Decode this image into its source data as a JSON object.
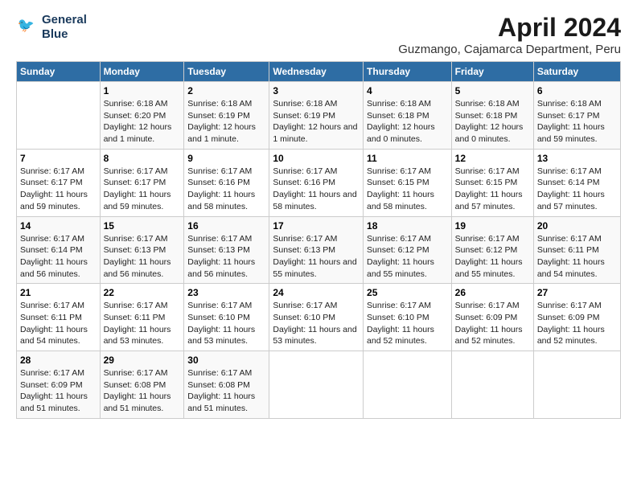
{
  "logo": {
    "line1": "General",
    "line2": "Blue"
  },
  "title": "April 2024",
  "subtitle": "Guzmango, Cajamarca Department, Peru",
  "weekdays": [
    "Sunday",
    "Monday",
    "Tuesday",
    "Wednesday",
    "Thursday",
    "Friday",
    "Saturday"
  ],
  "weeks": [
    [
      {
        "day": null
      },
      {
        "day": "1",
        "sunrise": "6:18 AM",
        "sunset": "6:20 PM",
        "daylight": "12 hours and 1 minute."
      },
      {
        "day": "2",
        "sunrise": "6:18 AM",
        "sunset": "6:19 PM",
        "daylight": "12 hours and 1 minute."
      },
      {
        "day": "3",
        "sunrise": "6:18 AM",
        "sunset": "6:19 PM",
        "daylight": "12 hours and 1 minute."
      },
      {
        "day": "4",
        "sunrise": "6:18 AM",
        "sunset": "6:18 PM",
        "daylight": "12 hours and 0 minutes."
      },
      {
        "day": "5",
        "sunrise": "6:18 AM",
        "sunset": "6:18 PM",
        "daylight": "12 hours and 0 minutes."
      },
      {
        "day": "6",
        "sunrise": "6:18 AM",
        "sunset": "6:17 PM",
        "daylight": "11 hours and 59 minutes."
      }
    ],
    [
      {
        "day": "7",
        "sunrise": "6:17 AM",
        "sunset": "6:17 PM",
        "daylight": "11 hours and 59 minutes."
      },
      {
        "day": "8",
        "sunrise": "6:17 AM",
        "sunset": "6:17 PM",
        "daylight": "11 hours and 59 minutes."
      },
      {
        "day": "9",
        "sunrise": "6:17 AM",
        "sunset": "6:16 PM",
        "daylight": "11 hours and 58 minutes."
      },
      {
        "day": "10",
        "sunrise": "6:17 AM",
        "sunset": "6:16 PM",
        "daylight": "11 hours and 58 minutes."
      },
      {
        "day": "11",
        "sunrise": "6:17 AM",
        "sunset": "6:15 PM",
        "daylight": "11 hours and 58 minutes."
      },
      {
        "day": "12",
        "sunrise": "6:17 AM",
        "sunset": "6:15 PM",
        "daylight": "11 hours and 57 minutes."
      },
      {
        "day": "13",
        "sunrise": "6:17 AM",
        "sunset": "6:14 PM",
        "daylight": "11 hours and 57 minutes."
      }
    ],
    [
      {
        "day": "14",
        "sunrise": "6:17 AM",
        "sunset": "6:14 PM",
        "daylight": "11 hours and 56 minutes."
      },
      {
        "day": "15",
        "sunrise": "6:17 AM",
        "sunset": "6:13 PM",
        "daylight": "11 hours and 56 minutes."
      },
      {
        "day": "16",
        "sunrise": "6:17 AM",
        "sunset": "6:13 PM",
        "daylight": "11 hours and 56 minutes."
      },
      {
        "day": "17",
        "sunrise": "6:17 AM",
        "sunset": "6:13 PM",
        "daylight": "11 hours and 55 minutes."
      },
      {
        "day": "18",
        "sunrise": "6:17 AM",
        "sunset": "6:12 PM",
        "daylight": "11 hours and 55 minutes."
      },
      {
        "day": "19",
        "sunrise": "6:17 AM",
        "sunset": "6:12 PM",
        "daylight": "11 hours and 55 minutes."
      },
      {
        "day": "20",
        "sunrise": "6:17 AM",
        "sunset": "6:11 PM",
        "daylight": "11 hours and 54 minutes."
      }
    ],
    [
      {
        "day": "21",
        "sunrise": "6:17 AM",
        "sunset": "6:11 PM",
        "daylight": "11 hours and 54 minutes."
      },
      {
        "day": "22",
        "sunrise": "6:17 AM",
        "sunset": "6:11 PM",
        "daylight": "11 hours and 53 minutes."
      },
      {
        "day": "23",
        "sunrise": "6:17 AM",
        "sunset": "6:10 PM",
        "daylight": "11 hours and 53 minutes."
      },
      {
        "day": "24",
        "sunrise": "6:17 AM",
        "sunset": "6:10 PM",
        "daylight": "11 hours and 53 minutes."
      },
      {
        "day": "25",
        "sunrise": "6:17 AM",
        "sunset": "6:10 PM",
        "daylight": "11 hours and 52 minutes."
      },
      {
        "day": "26",
        "sunrise": "6:17 AM",
        "sunset": "6:09 PM",
        "daylight": "11 hours and 52 minutes."
      },
      {
        "day": "27",
        "sunrise": "6:17 AM",
        "sunset": "6:09 PM",
        "daylight": "11 hours and 52 minutes."
      }
    ],
    [
      {
        "day": "28",
        "sunrise": "6:17 AM",
        "sunset": "6:09 PM",
        "daylight": "11 hours and 51 minutes."
      },
      {
        "day": "29",
        "sunrise": "6:17 AM",
        "sunset": "6:08 PM",
        "daylight": "11 hours and 51 minutes."
      },
      {
        "day": "30",
        "sunrise": "6:17 AM",
        "sunset": "6:08 PM",
        "daylight": "11 hours and 51 minutes."
      },
      {
        "day": null
      },
      {
        "day": null
      },
      {
        "day": null
      },
      {
        "day": null
      }
    ]
  ]
}
